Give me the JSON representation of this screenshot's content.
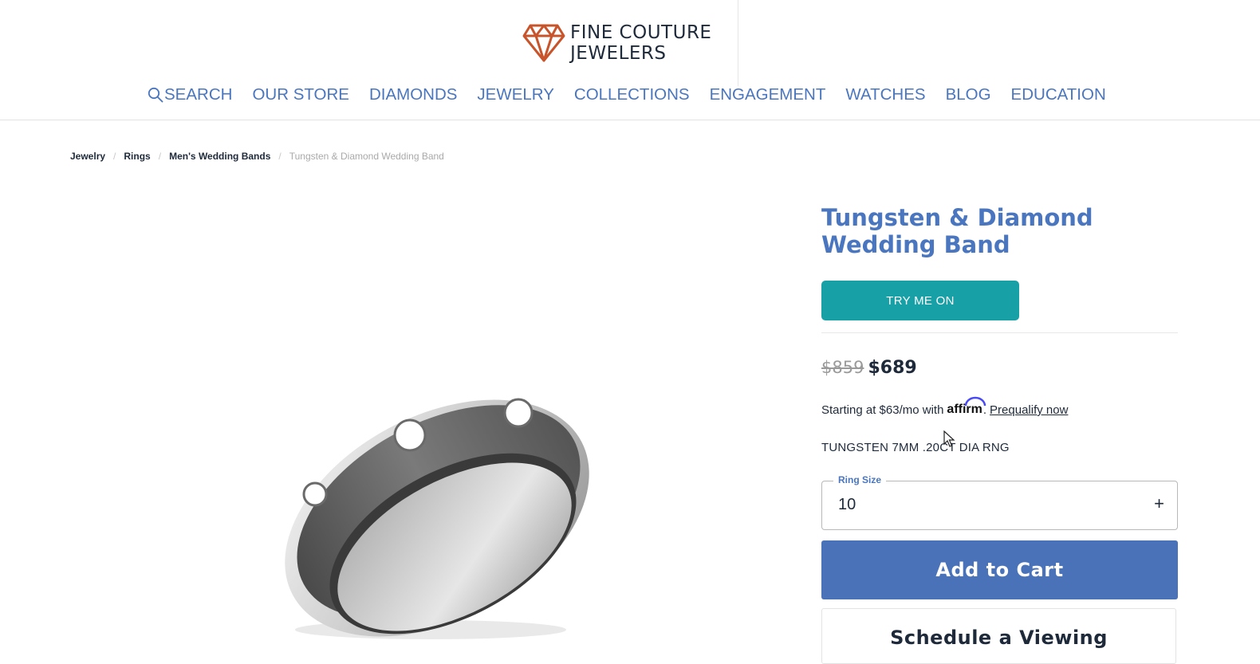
{
  "brand": {
    "line1": "FINE COUTURE",
    "line2": "JEWELERS",
    "accent_color": "#c7542a"
  },
  "nav": {
    "search_label": "SEARCH",
    "items": [
      "OUR STORE",
      "DIAMONDS",
      "JEWELRY",
      "COLLECTIONS",
      "ENGAGEMENT",
      "WATCHES",
      "BLOG",
      "EDUCATION"
    ],
    "color": "#4a76bf"
  },
  "breadcrumb": [
    "Jewelry",
    "Rings",
    "Men's Wedding Bands",
    "Tungsten & Diamond Wedding Band"
  ],
  "product": {
    "title": "Tungsten & Diamond Wedding Band",
    "try_on_label": "TRY ME ON",
    "old_price": "$859",
    "price": "$689",
    "financing_prefix": "Starting at $63/mo with",
    "financing_brand": "affirm",
    "financing_period": ".",
    "prequalify_label": "Prequalify now",
    "sku": "TUNGSTEN 7MM .20CT DIA RNG",
    "ring_size_label": "Ring Size",
    "ring_size_value": "10",
    "ring_size_increment": "+",
    "add_to_cart_label": "Add to Cart",
    "schedule_label": "Schedule a Viewing"
  },
  "icons": {
    "logo": "diamond-logo-icon",
    "search": "search-icon",
    "cursor": "mouse-cursor-icon"
  },
  "colors": {
    "teal": "#17a0a6",
    "cart_blue": "#4a72b8",
    "title_blue": "#4a76bf"
  }
}
